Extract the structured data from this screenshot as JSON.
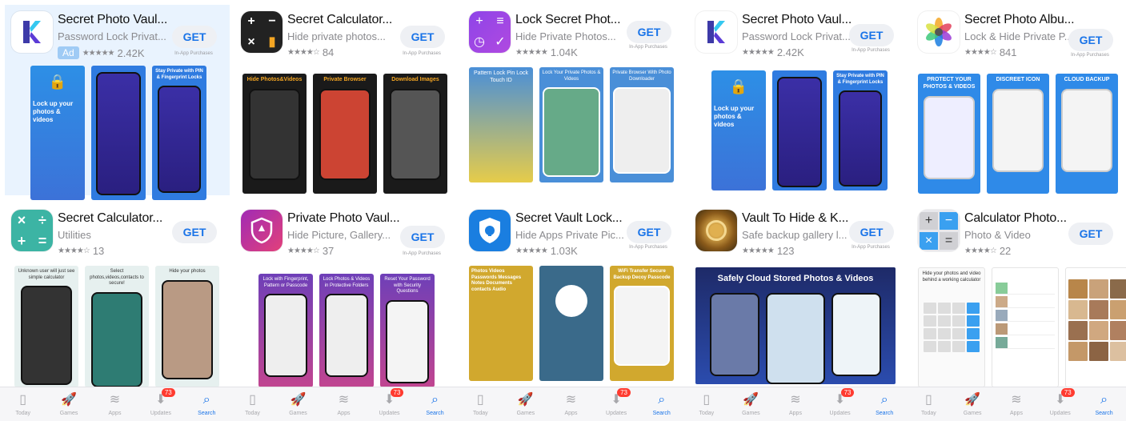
{
  "columns": [
    {
      "apps": [
        {
          "title": "Secret Photo Vaul...",
          "subtitle": "Password Lock Privat...",
          "ad": "Ad",
          "stars": "★★★★★",
          "count": "2.42K",
          "get": "GET",
          "iap": "In-App Purchases",
          "captions": [
            "Lock up your photos & videos",
            "",
            "Stay Private with PIN & Fingerprint Locks"
          ]
        },
        {
          "title": "Secret Calculator...",
          "subtitle": "Utilities",
          "stars": "★★★★☆",
          "count": "13",
          "get": "GET",
          "iap": "",
          "captions": [
            "Unknown user will just see simple calculator",
            "Select photos,videos,contacts to secure!",
            "Hide your photos"
          ]
        }
      ]
    },
    {
      "apps": [
        {
          "title": "Secret Calculator...",
          "subtitle": "Hide private photos...",
          "stars": "★★★★☆",
          "count": "84",
          "get": "GET",
          "iap": "In-App Purchases",
          "captions": [
            "Hide Photos&Videos",
            "Private Browser",
            "Download Images"
          ]
        },
        {
          "title": "Private Photo Vaul...",
          "subtitle": "Hide Picture, Gallery...",
          "stars": "★★★★☆",
          "count": "37",
          "get": "GET",
          "iap": "In-App Purchases",
          "captions": [
            "Lock with Fingerprint, Pattern or Passcode",
            "Lock Photos & Videos in Protective Folders",
            "Reset Your Password with Security Questions"
          ]
        }
      ]
    },
    {
      "apps": [
        {
          "title": "Lock Secret Phot...",
          "subtitle": "Hide Private Photos...",
          "stars": "★★★★★",
          "count": "1.04K",
          "get": "GET",
          "iap": "In-App Purchases",
          "captions": [
            "Pattern Lock Pin Lock Touch ID",
            "Lock Your Private Photos & Videos",
            "Private Browser With Photo Downloader"
          ]
        },
        {
          "title": "Secret Vault Lock...",
          "subtitle": "Hide Apps Private Pic...",
          "stars": "★★★★★",
          "count": "1.03K",
          "get": "GET",
          "iap": "In-App Purchases",
          "captions": [
            "Photos Videos Passwords Messages Notes Documents contacts Audio",
            "",
            "WiFi Transfer Secure Backup Decoy Passcode"
          ]
        }
      ]
    },
    {
      "apps": [
        {
          "title": "Secret Photo Vaul...",
          "subtitle": "Password Lock Privat...",
          "stars": "★★★★★",
          "count": "2.42K",
          "get": "GET",
          "iap": "In-App Purchases",
          "captions": [
            "Lock up your photos & videos",
            "",
            "Stay Private with PIN & Fingerprint Locks"
          ]
        },
        {
          "title": "Vault To Hide & K...",
          "subtitle": "Safe backup gallery l...",
          "stars": "★★★★★",
          "count": "123",
          "get": "GET",
          "iap": "In-App Purchases",
          "captions": [
            "Safely Cloud Stored Photos & Videos"
          ]
        }
      ]
    },
    {
      "apps": [
        {
          "title": "Secret Photo Albu...",
          "subtitle": "Lock & Hide Private P...",
          "stars": "★★★★☆",
          "count": "841",
          "get": "GET",
          "iap": "In-App Purchases",
          "captions": [
            "PROTECT YOUR PHOTOS & VIDEOS",
            "DISCREET ICON",
            "CLOUD BACKUP"
          ]
        },
        {
          "title": "Calculator Photo...",
          "subtitle": "Photo & Video",
          "stars": "★★★★☆",
          "count": "22",
          "get": "GET",
          "iap": "",
          "captions": [
            "Hide your photos and video behind a working calculator"
          ]
        }
      ]
    }
  ],
  "tabbar": {
    "today": "Today",
    "games": "Games",
    "apps": "Apps",
    "updates": "Updates",
    "search": "Search",
    "badge": "73"
  },
  "colors": {
    "accent": "#1a74e8",
    "badge": "#ff3b30",
    "get_bg": "#eef0f4"
  }
}
